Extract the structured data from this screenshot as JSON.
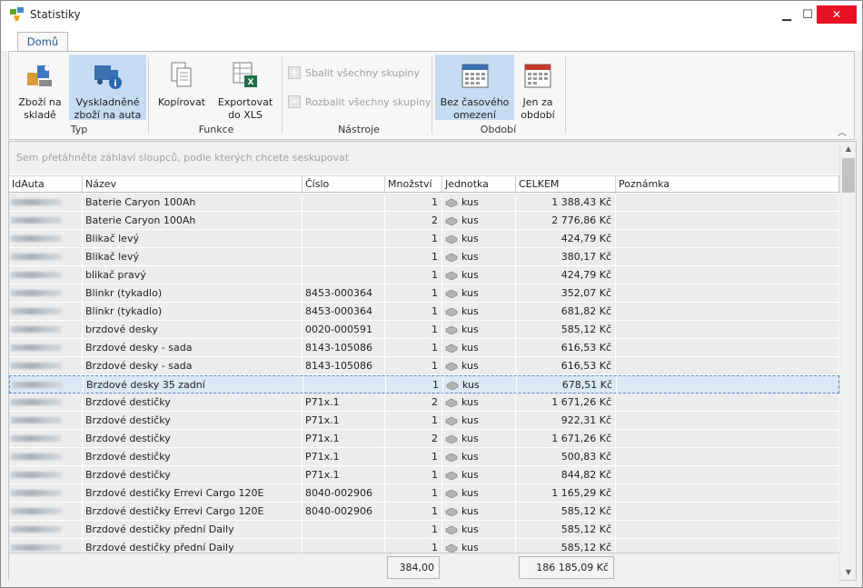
{
  "window": {
    "title": "Statistiky",
    "minimize": "▁",
    "maximize": "☐",
    "close": "✕"
  },
  "tabs": [
    {
      "label": "Domů"
    }
  ],
  "ribbon": {
    "typ": {
      "label": "Typ",
      "items": [
        {
          "label": "Zboží na skladě"
        },
        {
          "label": "Vyskladněné zboží na auta"
        }
      ]
    },
    "funkce": {
      "label": "Funkce",
      "items": [
        {
          "label": "Kopírovat"
        },
        {
          "label": "Exportovat do XLS"
        }
      ]
    },
    "nastroje": {
      "label": "Nástroje",
      "items": [
        {
          "label": "Sbalit všechny skupiny"
        },
        {
          "label": "Rozbalit všechny skupiny"
        }
      ]
    },
    "obdobi": {
      "label": "Období",
      "items": [
        {
          "label": "Bez časového omezení"
        },
        {
          "label": "Jen za období"
        }
      ]
    }
  },
  "grid": {
    "group_hint": "Sem přetáhněte záhlaví sloupců, podle kterých chcete seskupovat",
    "columns": [
      "IdAuta",
      "Název",
      "Číslo",
      "Množství",
      "Jednotka",
      "CELKEM",
      "Poznámka"
    ],
    "rows": [
      {
        "nazev": "Baterie Caryon 100Ah",
        "cislo": "",
        "mnozstvi": "1",
        "jednotka": "kus",
        "celkem": "1 388,43 Kč",
        "poznamka": ""
      },
      {
        "nazev": "Baterie Caryon 100Ah",
        "cislo": "",
        "mnozstvi": "2",
        "jednotka": "kus",
        "celkem": "2 776,86 Kč",
        "poznamka": ""
      },
      {
        "nazev": "Blikač levý",
        "cislo": "",
        "mnozstvi": "1",
        "jednotka": "kus",
        "celkem": "424,79 Kč",
        "poznamka": ""
      },
      {
        "nazev": "Blikač levý",
        "cislo": "",
        "mnozstvi": "1",
        "jednotka": "kus",
        "celkem": "380,17 Kč",
        "poznamka": ""
      },
      {
        "nazev": "blikač pravý",
        "cislo": "",
        "mnozstvi": "1",
        "jednotka": "kus",
        "celkem": "424,79 Kč",
        "poznamka": ""
      },
      {
        "nazev": "Blinkr (tykadlo)",
        "cislo": "8453-000364",
        "mnozstvi": "1",
        "jednotka": "kus",
        "celkem": "352,07 Kč",
        "poznamka": ""
      },
      {
        "nazev": "Blinkr (tykadlo)",
        "cislo": "8453-000364",
        "mnozstvi": "1",
        "jednotka": "kus",
        "celkem": "681,82 Kč",
        "poznamka": ""
      },
      {
        "nazev": "brzdové desky",
        "cislo": "0020-000591",
        "mnozstvi": "1",
        "jednotka": "kus",
        "celkem": "585,12 Kč",
        "poznamka": ""
      },
      {
        "nazev": "Brzdové desky - sada",
        "cislo": "8143-105086",
        "mnozstvi": "1",
        "jednotka": "kus",
        "celkem": "616,53 Kč",
        "poznamka": ""
      },
      {
        "nazev": "Brzdové desky - sada",
        "cislo": "8143-105086",
        "mnozstvi": "1",
        "jednotka": "kus",
        "celkem": "616,53 Kč",
        "poznamka": ""
      },
      {
        "nazev": "Brzdové desky 35 zadní",
        "cislo": "",
        "mnozstvi": "1",
        "jednotka": "kus",
        "celkem": "678,51 Kč",
        "poznamka": "",
        "selected": true
      },
      {
        "nazev": "Brzdové destičky",
        "cislo": "P71x.1",
        "mnozstvi": "2",
        "jednotka": "kus",
        "celkem": "1 671,26 Kč",
        "poznamka": ""
      },
      {
        "nazev": "Brzdové destičky",
        "cislo": "P71x.1",
        "mnozstvi": "1",
        "jednotka": "kus",
        "celkem": "922,31 Kč",
        "poznamka": ""
      },
      {
        "nazev": "Brzdové destičky",
        "cislo": "P71x.1",
        "mnozstvi": "2",
        "jednotka": "kus",
        "celkem": "1 671,26 Kč",
        "poznamka": ""
      },
      {
        "nazev": "Brzdové destičky",
        "cislo": "P71x.1",
        "mnozstvi": "1",
        "jednotka": "kus",
        "celkem": "500,83 Kč",
        "poznamka": ""
      },
      {
        "nazev": "Brzdové destičky",
        "cislo": "P71x.1",
        "mnozstvi": "1",
        "jednotka": "kus",
        "celkem": "844,82 Kč",
        "poznamka": ""
      },
      {
        "nazev": "Brzdové destičky Errevi Cargo 120E",
        "cislo": "8040-002906",
        "mnozstvi": "1",
        "jednotka": "kus",
        "celkem": "1 165,29 Kč",
        "poznamka": ""
      },
      {
        "nazev": "Brzdové destičky Errevi Cargo 120E",
        "cislo": "8040-002906",
        "mnozstvi": "1",
        "jednotka": "kus",
        "celkem": "585,12 Kč",
        "poznamka": ""
      },
      {
        "nazev": "Brzdové destičky přední Daily",
        "cislo": "",
        "mnozstvi": "1",
        "jednotka": "kus",
        "celkem": "585,12 Kč",
        "poznamka": ""
      },
      {
        "nazev": "Brzdové destičky přední Daily",
        "cislo": "",
        "mnozstvi": "1",
        "jednotka": "kus",
        "celkem": "585,12 Kč",
        "poznamka": ""
      }
    ],
    "totals": {
      "mnozstvi": "384,00",
      "celkem": "186 185,09 Kč"
    }
  },
  "colors": {
    "accent": "#2b579a",
    "selected_button": "#c5dcf2",
    "close": "#e81123"
  }
}
